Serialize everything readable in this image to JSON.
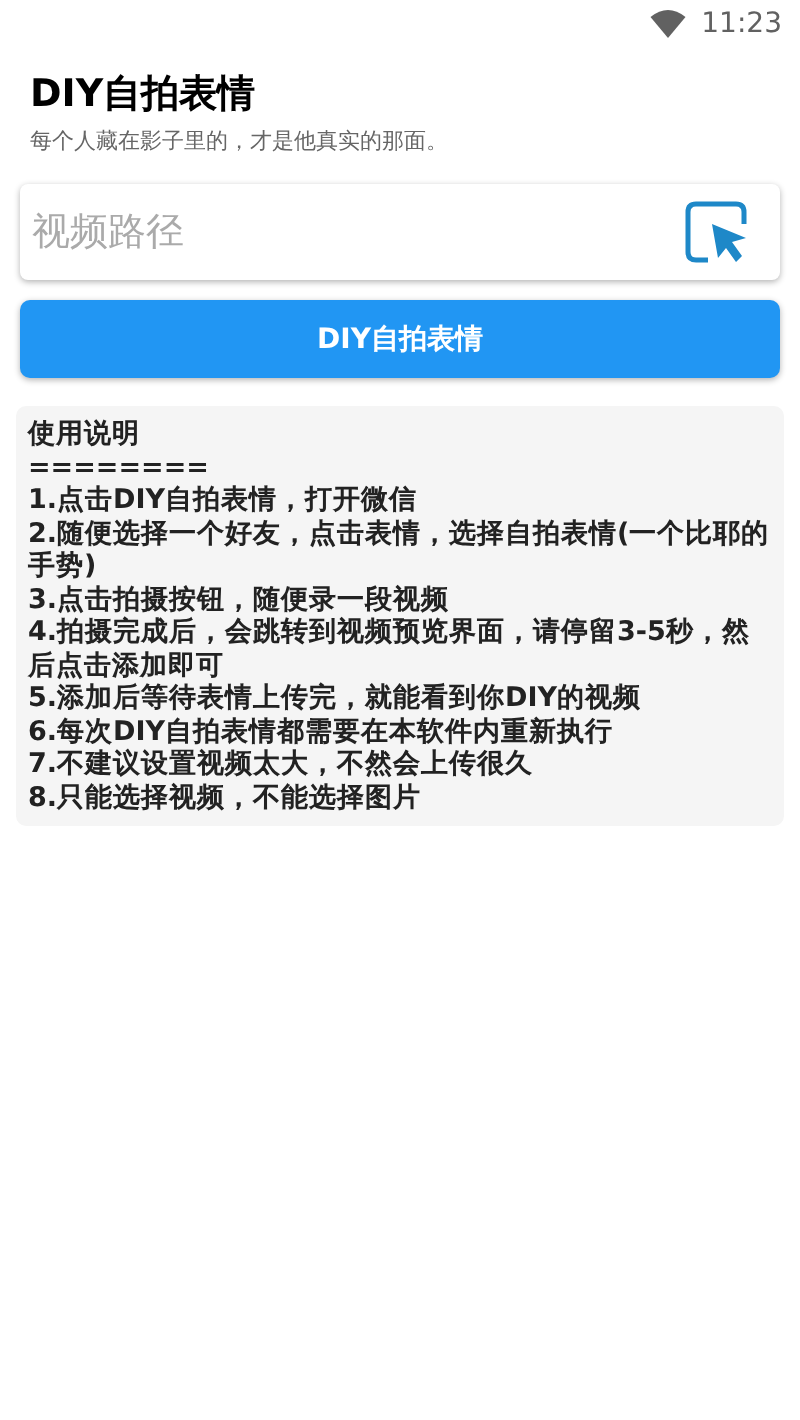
{
  "status_bar": {
    "time": "11:23"
  },
  "header": {
    "title": "DIY自拍表情",
    "subtitle": "每个人藏在影子里的，才是他真实的那面。"
  },
  "path_field": {
    "placeholder": "视频路径"
  },
  "action_button": {
    "label": "DIY自拍表情"
  },
  "instructions": {
    "title": "使用说明",
    "divider": "========",
    "lines": [
      "1.点击DIY自拍表情，打开微信",
      "2.随便选择一个好友，点击表情，选择自拍表情(一个比耶的手势)",
      "3.点击拍摄按钮，随便录一段视频",
      "4.拍摄完成后，会跳转到视频预览界面，请停留3-5秒，然后点击添加即可",
      "5.添加后等待表情上传完，就能看到你DIY的视频",
      "6.每次DIY自拍表情都需要在本软件内重新执行",
      "7.不建议设置视频太大，不然会上传很久",
      "8.只能选择视频，不能选择图片"
    ]
  }
}
